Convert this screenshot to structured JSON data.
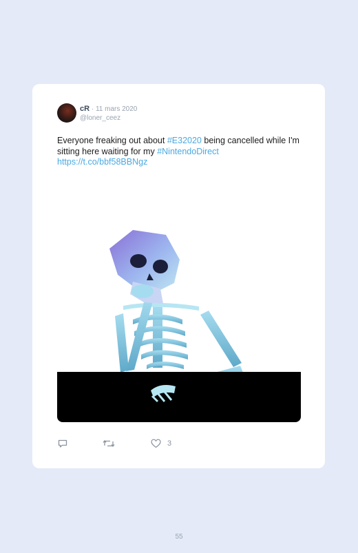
{
  "tweet": {
    "author_name": "cR",
    "separator": " · ",
    "date": "11 mars 2020",
    "handle": "@loner_ceez",
    "text_before": "Everyone freaking out about ",
    "hashtag_1": "#E32020",
    "text_middle": " being cancelled while I'm sitting here waiting for my ",
    "hashtag_2": "#NintendoDirect",
    "link": "https://t.co/bbf58BBNgz",
    "media_description_icon": "waiting-skeleton-image",
    "like_count": "3"
  },
  "actions": {
    "reply_icon": "reply-icon",
    "retweet_icon": "retweet-icon",
    "like_icon": "heart-icon"
  },
  "page": {
    "number": "55"
  },
  "colors": {
    "background": "#e4eaf7",
    "card": "#ffffff",
    "link": "#4aa9e0",
    "muted": "#9aa3b0"
  }
}
